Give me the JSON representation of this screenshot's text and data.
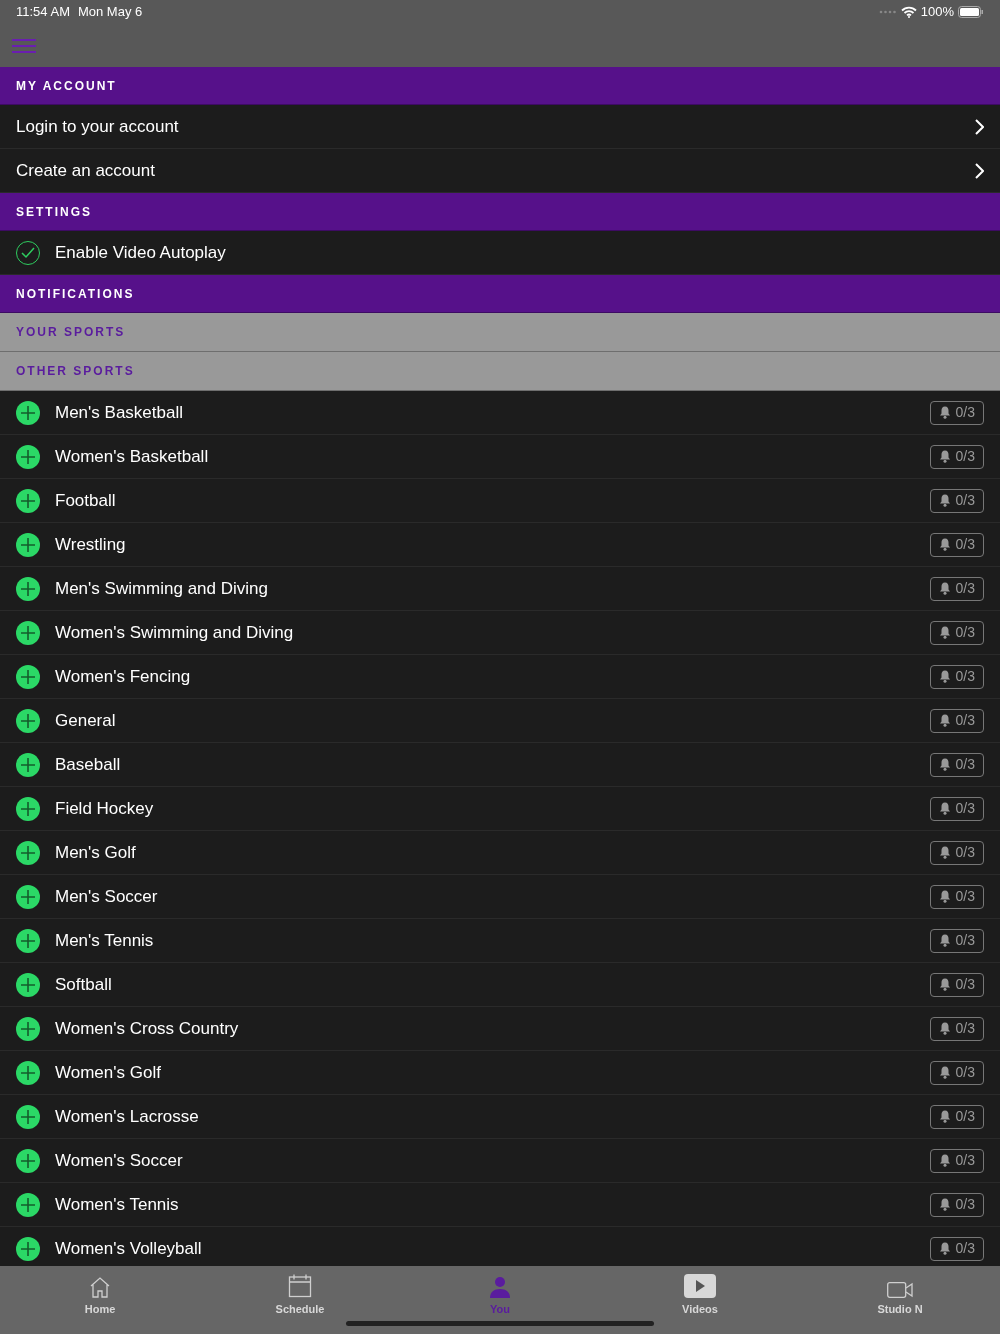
{
  "status_bar": {
    "time": "11:54 AM",
    "date": "Mon May 6",
    "battery": "100%"
  },
  "sections": [
    {
      "kind": "links",
      "title": "MY ACCOUNT",
      "items": [
        {
          "label": "Login to your account"
        },
        {
          "label": "Create an account"
        }
      ]
    },
    {
      "kind": "toggles",
      "title": "SETTINGS",
      "items": [
        {
          "label": "Enable Video Autoplay",
          "checked": true
        }
      ]
    },
    {
      "kind": "heading",
      "title": "NOTIFICATIONS"
    },
    {
      "kind": "subheading",
      "title": "YOUR SPORTS"
    },
    {
      "kind": "subheading",
      "title": "OTHER SPORTS"
    },
    {
      "kind": "sports",
      "items": [
        {
          "label": "Men's Basketball",
          "count": "0/3"
        },
        {
          "label": "Women's Basketball",
          "count": "0/3"
        },
        {
          "label": "Football",
          "count": "0/3"
        },
        {
          "label": "Wrestling",
          "count": "0/3"
        },
        {
          "label": "Men's Swimming and Diving",
          "count": "0/3"
        },
        {
          "label": "Women's Swimming and Diving",
          "count": "0/3"
        },
        {
          "label": "Women's Fencing",
          "count": "0/3"
        },
        {
          "label": "General",
          "count": "0/3"
        },
        {
          "label": "Baseball",
          "count": "0/3"
        },
        {
          "label": "Field Hockey",
          "count": "0/3"
        },
        {
          "label": "Men's Golf",
          "count": "0/3"
        },
        {
          "label": "Men's Soccer",
          "count": "0/3"
        },
        {
          "label": "Men's Tennis",
          "count": "0/3"
        },
        {
          "label": "Softball",
          "count": "0/3"
        },
        {
          "label": "Women's Cross Country",
          "count": "0/3"
        },
        {
          "label": "Women's Golf",
          "count": "0/3"
        },
        {
          "label": "Women's Lacrosse",
          "count": "0/3"
        },
        {
          "label": "Women's Soccer",
          "count": "0/3"
        },
        {
          "label": "Women's Tennis",
          "count": "0/3"
        },
        {
          "label": "Women's Volleyball",
          "count": "0/3"
        }
      ]
    }
  ],
  "tab_bar": [
    {
      "kind": "home",
      "label": "Home",
      "selected": false
    },
    {
      "kind": "schedule",
      "label": "Schedule",
      "selected": false
    },
    {
      "kind": "you",
      "label": "You",
      "selected": true
    },
    {
      "kind": "videos",
      "label": "Videos",
      "selected": false
    },
    {
      "kind": "studio",
      "label": "Studio N",
      "selected": false
    }
  ]
}
